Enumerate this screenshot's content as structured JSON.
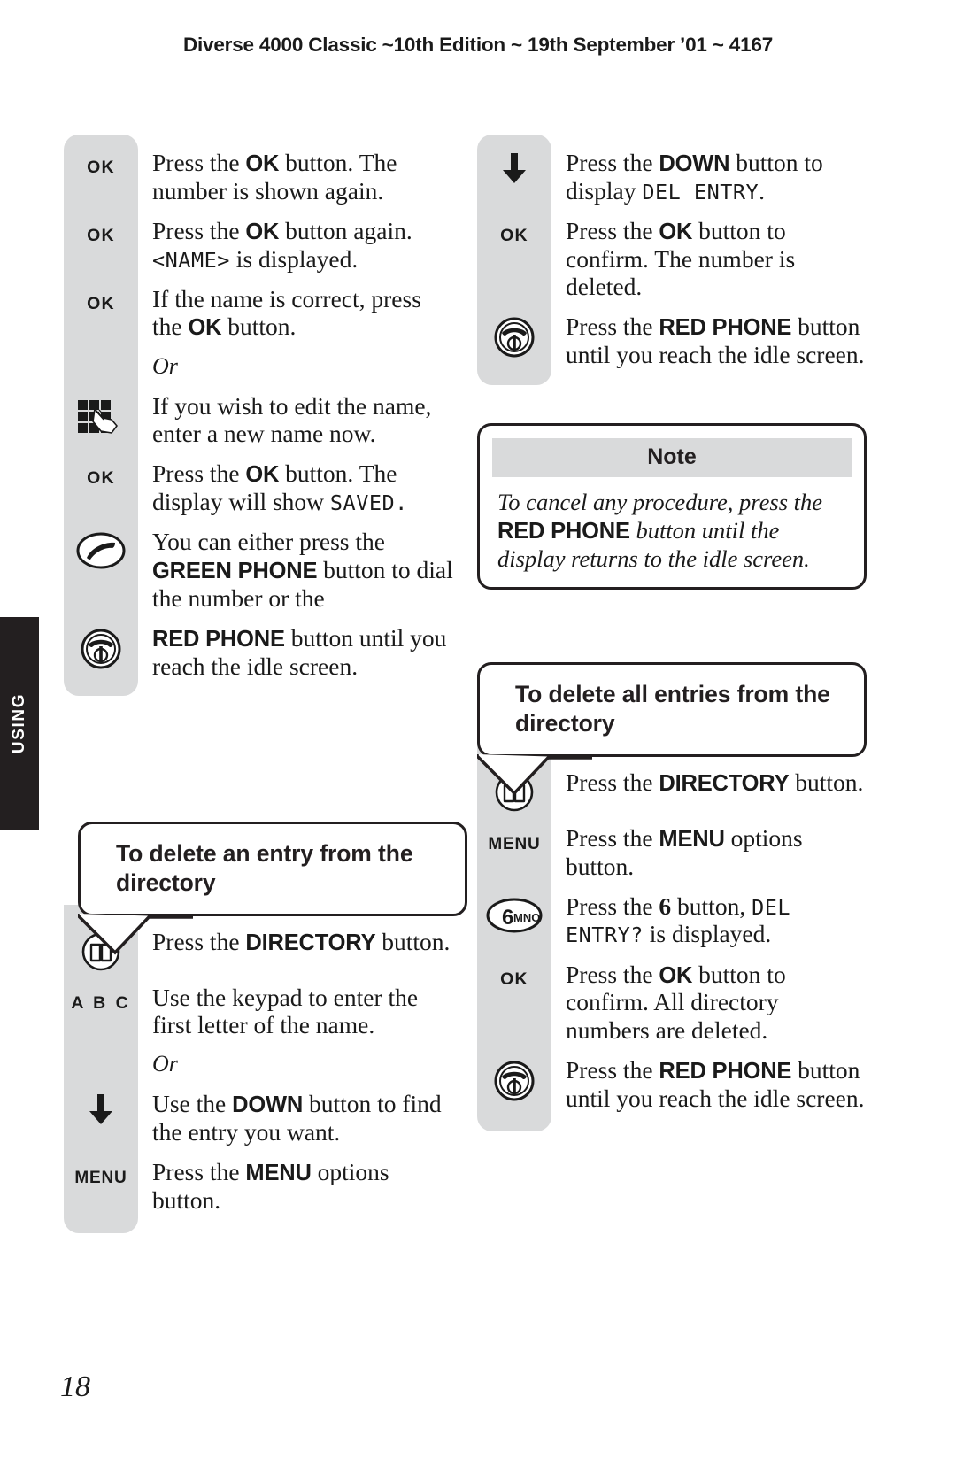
{
  "header": {
    "title": "Diverse 4000 Classic ~10th Edition ~ 19th September ’01 ~ 4167"
  },
  "side_tab": {
    "label": "USING"
  },
  "page_number": "18",
  "icons": {
    "ok": "OK",
    "menu": "MENU",
    "abc": "A B C",
    "key6_digit": "6",
    "key6_letters": "MNO"
  },
  "left_column": {
    "group1": {
      "steps": [
        {
          "icon": "ok-key-icon",
          "icon_label": "OK",
          "parts": [
            {
              "t": "Press the ",
              "style": "normal"
            },
            {
              "t": "OK",
              "style": "bold"
            },
            {
              "t": " button. The number is shown again.",
              "style": "normal"
            }
          ]
        },
        {
          "icon": "ok-key-icon",
          "icon_label": "OK",
          "parts": [
            {
              "t": "Press the ",
              "style": "normal"
            },
            {
              "t": "OK",
              "style": "bold"
            },
            {
              "t": " button again. ",
              "style": "normal"
            },
            {
              "t": "<NAME>",
              "style": "lcd"
            },
            {
              "t": " is displayed.",
              "style": "normal"
            }
          ]
        },
        {
          "icon": "ok-key-icon",
          "icon_label": "OK",
          "parts": [
            {
              "t": "If the name is correct, press the ",
              "style": "normal"
            },
            {
              "t": "OK",
              "style": "bold"
            },
            {
              "t": " button.",
              "style": "normal"
            }
          ]
        },
        {
          "icon": "none",
          "icon_label": "",
          "or": true,
          "parts": [
            {
              "t": "Or",
              "style": "italic"
            }
          ]
        },
        {
          "icon": "keypad-hand-icon",
          "icon_label": "",
          "parts": [
            {
              "t": "If you wish to edit the name, enter a new name now.",
              "style": "normal"
            }
          ]
        },
        {
          "icon": "ok-key-icon",
          "icon_label": "OK",
          "parts": [
            {
              "t": "Press the ",
              "style": "normal"
            },
            {
              "t": "OK",
              "style": "bold"
            },
            {
              "t": " button. The display will show ",
              "style": "normal"
            },
            {
              "t": "SAVED.",
              "style": "lcd"
            }
          ]
        },
        {
          "icon": "green-phone-icon",
          "icon_label": "",
          "parts": [
            {
              "t": "You can either press the ",
              "style": "normal"
            },
            {
              "t": "GREEN PHONE",
              "style": "bold"
            },
            {
              "t": " button to dial the number or the ",
              "style": "normal"
            }
          ]
        },
        {
          "icon": "red-phone-icon",
          "icon_label": "",
          "parts": [
            {
              "t": "RED PHONE",
              "style": "bold"
            },
            {
              "t": " button until you reach the idle screen.",
              "style": "normal"
            }
          ]
        }
      ]
    },
    "callout": {
      "title": "To delete an entry from the directory"
    },
    "group2": {
      "steps": [
        {
          "icon": "directory-book-icon",
          "icon_label": "",
          "parts": [
            {
              "t": "Press the ",
              "style": "normal"
            },
            {
              "t": "DIRECTORY",
              "style": "bold"
            },
            {
              "t": " button.",
              "style": "normal"
            }
          ]
        },
        {
          "icon": "abc-key-icon",
          "icon_label": "A B C",
          "parts": [
            {
              "t": "Use the keypad to enter the first letter of the name.",
              "style": "normal"
            }
          ]
        },
        {
          "icon": "none",
          "icon_label": "",
          "or": true,
          "parts": [
            {
              "t": "Or",
              "style": "italic"
            }
          ]
        },
        {
          "icon": "down-arrow-icon",
          "icon_label": "",
          "parts": [
            {
              "t": "Use the ",
              "style": "normal"
            },
            {
              "t": "DOWN",
              "style": "bold"
            },
            {
              "t": " button to find the entry you want.",
              "style": "normal"
            }
          ]
        },
        {
          "icon": "menu-key-icon",
          "icon_label": "MENU",
          "parts": [
            {
              "t": "Press the ",
              "style": "normal"
            },
            {
              "t": "MENU",
              "style": "bold"
            },
            {
              "t": " options button.",
              "style": "normal"
            }
          ]
        }
      ]
    }
  },
  "right_column": {
    "group1": {
      "steps": [
        {
          "icon": "down-arrow-icon",
          "icon_label": "",
          "parts": [
            {
              "t": "Press the ",
              "style": "normal"
            },
            {
              "t": "DOWN",
              "style": "bold"
            },
            {
              "t": " button to display ",
              "style": "normal"
            },
            {
              "t": "DEL ENTRY",
              "style": "lcd"
            },
            {
              "t": ".",
              "style": "normal"
            }
          ]
        },
        {
          "icon": "ok-key-icon",
          "icon_label": "OK",
          "parts": [
            {
              "t": "Press the ",
              "style": "normal"
            },
            {
              "t": "OK",
              "style": "bold"
            },
            {
              "t": " button to confirm. The number is deleted.",
              "style": "normal"
            }
          ]
        },
        {
          "icon": "red-phone-icon",
          "icon_label": "",
          "parts": [
            {
              "t": "Press the ",
              "style": "normal"
            },
            {
              "t": "RED PHONE",
              "style": "bold"
            },
            {
              "t": " button until you reach the idle screen.",
              "style": "normal"
            }
          ]
        }
      ]
    },
    "note": {
      "header": "Note",
      "parts": [
        {
          "t": "To cancel any procedure, press the ",
          "style": "italic"
        },
        {
          "t": "RED PHONE",
          "style": "bold"
        },
        {
          "t": " button until the display returns to the idle screen.",
          "style": "italic"
        }
      ]
    },
    "callout": {
      "title": "To delete all entries from the directory"
    },
    "group2": {
      "steps": [
        {
          "icon": "directory-book-icon",
          "icon_label": "",
          "parts": [
            {
              "t": "Press the ",
              "style": "normal"
            },
            {
              "t": "DIRECTORY",
              "style": "bold"
            },
            {
              "t": " button.",
              "style": "normal"
            }
          ]
        },
        {
          "icon": "menu-key-icon",
          "icon_label": "MENU",
          "parts": [
            {
              "t": "Press the ",
              "style": "normal"
            },
            {
              "t": "MENU",
              "style": "bold"
            },
            {
              "t": " options button.",
              "style": "normal"
            }
          ]
        },
        {
          "icon": "key6-mno-icon",
          "icon_label": "",
          "parts": [
            {
              "t": "Press the ",
              "style": "normal"
            },
            {
              "t": "6",
              "style": "bold-serif"
            },
            {
              "t": " button, ",
              "style": "normal"
            },
            {
              "t": "DEL ENTRY?",
              "style": "lcd"
            },
            {
              "t": " is displayed.",
              "style": "normal"
            }
          ]
        },
        {
          "icon": "ok-key-icon",
          "icon_label": "OK",
          "parts": [
            {
              "t": "Press the ",
              "style": "normal"
            },
            {
              "t": "OK",
              "style": "bold"
            },
            {
              "t": " button to confirm. All directory numbers are deleted.",
              "style": "normal"
            }
          ]
        },
        {
          "icon": "red-phone-icon",
          "icon_label": "",
          "parts": [
            {
              "t": "Press the ",
              "style": "normal"
            },
            {
              "t": "RED PHONE",
              "style": "bold"
            },
            {
              "t": " button until you reach the idle screen.",
              "style": "normal"
            }
          ]
        }
      ]
    }
  }
}
